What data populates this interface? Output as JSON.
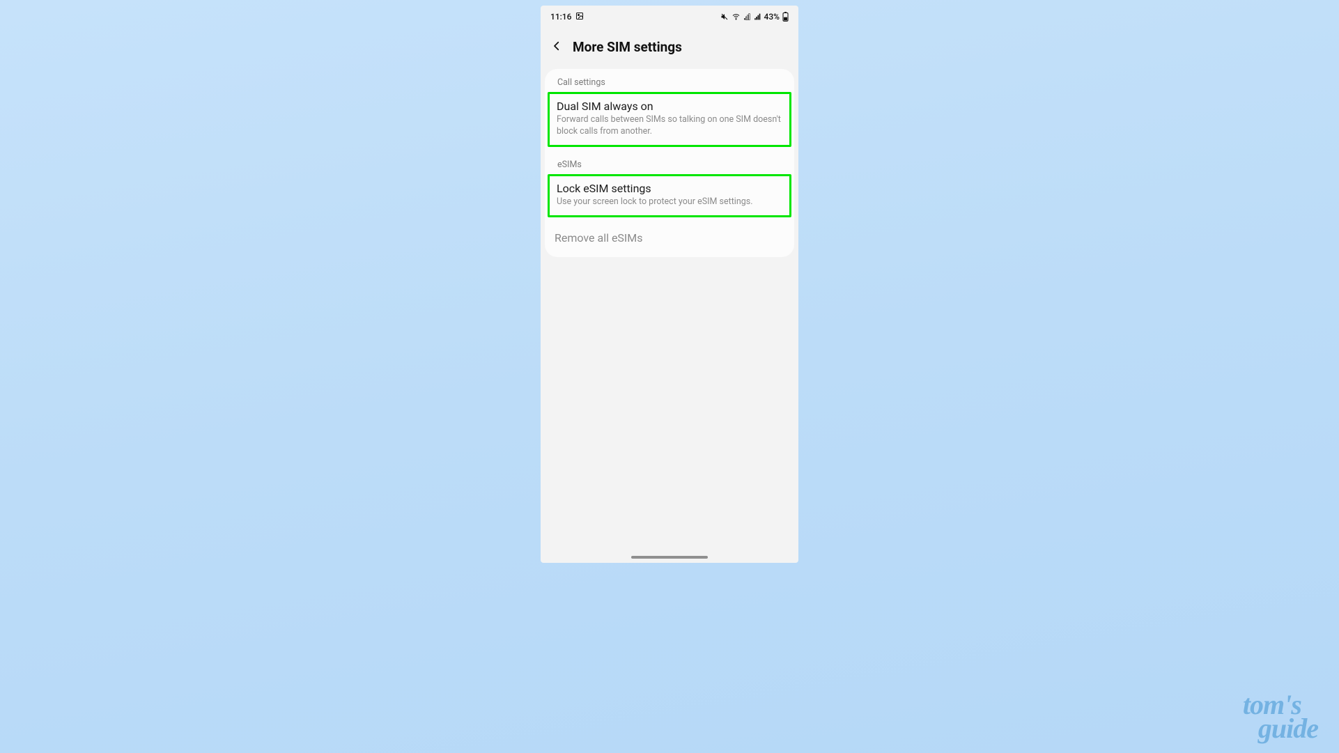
{
  "status": {
    "time": "11:16",
    "battery_text": "43%"
  },
  "header": {
    "title": "More SIM settings"
  },
  "sections": {
    "call": {
      "label": "Call settings",
      "dual_sim": {
        "title": "Dual SIM always on",
        "desc": "Forward calls between SIMs so talking on one SIM doesn't block calls from another."
      }
    },
    "esims": {
      "label": "eSIMs",
      "lock": {
        "title": "Lock eSIM settings",
        "desc": "Use your screen lock to protect your eSIM settings."
      },
      "remove": {
        "title": "Remove all eSIMs"
      }
    }
  },
  "watermark": {
    "line1": "tom's",
    "line2": "guide"
  },
  "colors": {
    "highlight": "#00e600",
    "bg_gradient_top": "#c6e2fa",
    "bg_gradient_bottom": "#b5d8f7"
  }
}
